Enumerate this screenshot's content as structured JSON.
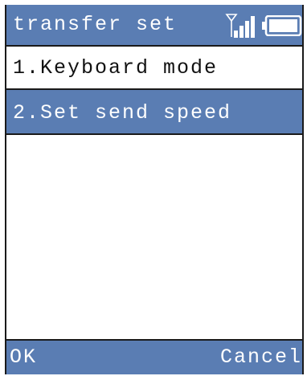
{
  "header": {
    "title": "transfer set",
    "signal_icon": "signal-strength-icon",
    "battery_icon": "battery-icon"
  },
  "menu": {
    "items": [
      {
        "label": "1.Keyboard mode",
        "selected": false
      },
      {
        "label": "2.Set send speed",
        "selected": true
      }
    ]
  },
  "softkeys": {
    "left": "OK",
    "right": "Cancel"
  },
  "colors": {
    "accent": "#5a7db3",
    "background": "#ffffff",
    "text": "#111111",
    "text_on_accent": "#ffffff"
  }
}
